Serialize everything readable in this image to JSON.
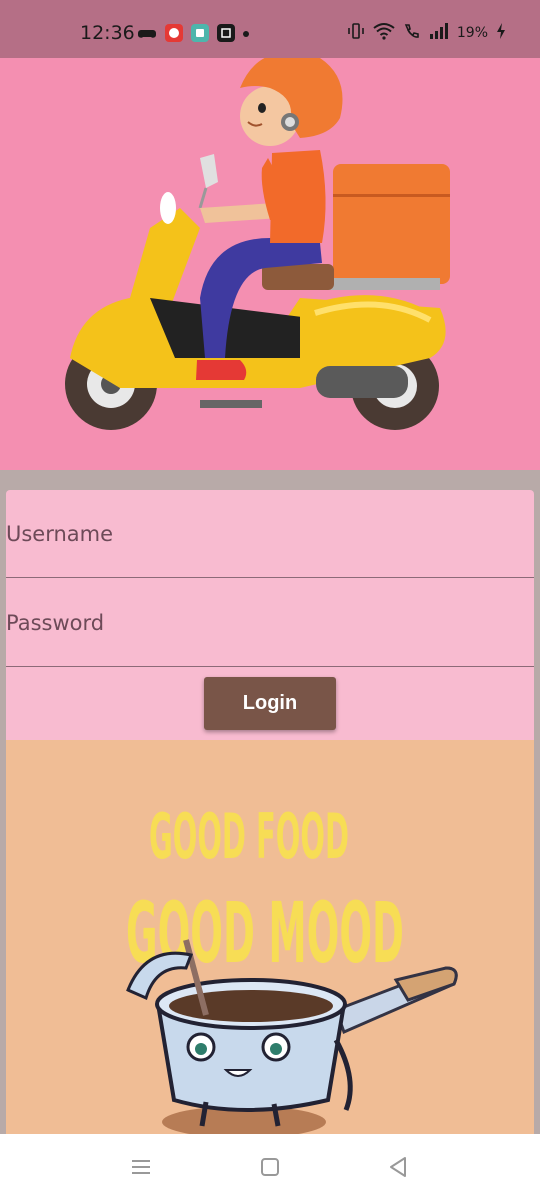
{
  "status_bar": {
    "time": "12:36",
    "battery": "19%",
    "icons": [
      "game-controller-icon",
      "app-icon-red",
      "app-icon-green",
      "app-icon-dark",
      "vibrate-icon",
      "wifi-icon",
      "wifi-call-icon",
      "signal-icon",
      "battery-charging-icon"
    ]
  },
  "login_form": {
    "username_placeholder": "Username",
    "password_placeholder": "Password",
    "login_label": "Login"
  },
  "poster": {
    "line1": "GOOD FOOD",
    "line2": "GOOD MOOD"
  },
  "nav_bar": {
    "icons": [
      "menu-icon",
      "home-icon",
      "back-icon"
    ]
  },
  "colors": {
    "status_bar": "#b56f86",
    "hero_bg": "#f48fb1",
    "form_bg": "#f8bbd0",
    "button": "#795548",
    "poster_bg": "#f0bd95",
    "poster_text": "#f7dd55"
  }
}
